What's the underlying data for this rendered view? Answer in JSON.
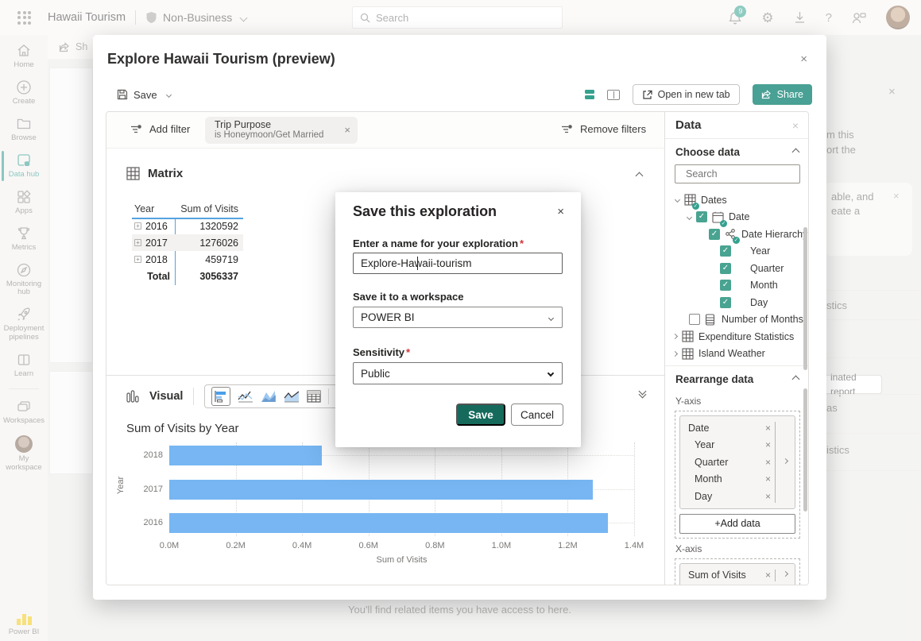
{
  "colors": {
    "accent_teal": "#35a18e",
    "share_button_teal": "#49a094",
    "save_button_green": "#156a5c",
    "bar_blue": "#77b6f2",
    "matrix_line_blue": "#55a2e0",
    "required_red": "#d13438",
    "powerbi_yellow": "#f2c811"
  },
  "topbar": {
    "product": "Hawaii Tourism",
    "sensitivity_badge": "Non-Business",
    "search_placeholder": "Search",
    "notification_count": "9"
  },
  "sidebar": {
    "items": [
      {
        "label": "Home"
      },
      {
        "label": "Create"
      },
      {
        "label": "Browse"
      },
      {
        "label": "Data hub"
      },
      {
        "label": "Apps"
      },
      {
        "label": "Metrics"
      },
      {
        "label": "Monitoring hub"
      },
      {
        "label": "Deployment pipelines"
      },
      {
        "label": "Learn"
      },
      {
        "label": "Workspaces"
      },
      {
        "label": "My workspace"
      }
    ],
    "active_item": "Data hub",
    "footer": "Power BI"
  },
  "explorer": {
    "title": "Explore Hawaii Tourism (preview)",
    "toolbar": {
      "save": "Save",
      "open_in_new_tab": "Open in new tab",
      "share": "Share"
    },
    "filters": {
      "add": "Add filter",
      "remove": "Remove filters",
      "pill_field": "Trip Purpose",
      "pill_condition": "is Honeymoon/Get Married"
    },
    "matrix": {
      "label": "Matrix",
      "col_year": "Year",
      "col_visits": "Sum of Visits",
      "rows": [
        {
          "year": "2016",
          "visits": "1320592"
        },
        {
          "year": "2017",
          "visits": "1276026"
        },
        {
          "year": "2018",
          "visits": "459719"
        }
      ],
      "total_label": "Total",
      "total_visits": "3056337"
    },
    "visual": {
      "label": "Visual"
    }
  },
  "chart_data": {
    "type": "bar",
    "orientation": "horizontal",
    "title": "Sum of Visits by Year",
    "categories": [
      "2018",
      "2017",
      "2016"
    ],
    "values": [
      459719,
      1276026,
      1320592
    ],
    "xlabel": "Sum of Visits",
    "ylabel": "Year",
    "xlim": [
      0,
      1400000
    ],
    "x_ticks": [
      "0.0M",
      "0.2M",
      "0.4M",
      "0.6M",
      "0.8M",
      "1.0M",
      "1.2M",
      "1.4M"
    ],
    "grid": true,
    "legend": false,
    "bar_color": "#77b6f2"
  },
  "modal": {
    "title": "Save this exploration",
    "name_label": "Enter a name for your exploration",
    "name_value": "Explore-Hawaii-tourism",
    "workspace_label": "Save it to a workspace",
    "workspace_value": "POWER BI",
    "sensitivity_label": "Sensitivity",
    "sensitivity_value": "Public",
    "save": "Save",
    "cancel": "Cancel"
  },
  "data_panel": {
    "title": "Data",
    "choose_data": "Choose data",
    "search_placeholder": "Search",
    "tree": [
      {
        "label": "Dates"
      },
      {
        "label": "Date"
      },
      {
        "label": "Date Hierarchy"
      },
      {
        "label": "Year"
      },
      {
        "label": "Quarter"
      },
      {
        "label": "Month"
      },
      {
        "label": "Day"
      },
      {
        "label": "Number of Months"
      },
      {
        "label": "Expenditure Statistics"
      },
      {
        "label": "Island Weather"
      }
    ],
    "rearrange": "Rearrange data",
    "y_axis_label": "Y-axis",
    "y_fields": [
      "Date",
      "Year",
      "Quarter",
      "Month",
      "Day"
    ],
    "add_data": "+Add data",
    "x_axis_label": "X-axis",
    "x_fields": [
      "Sum of Visits"
    ]
  },
  "background": {
    "share_tab": "Sh",
    "right_line1": "m this",
    "right_line2": "ort the",
    "card_line1": "able, and",
    "card_line2": "eate a",
    "card_button": "inated report",
    "item1": "stics",
    "item2": "as",
    "item3": "istics",
    "bottom_note": "You'll find related items you have access to here."
  }
}
